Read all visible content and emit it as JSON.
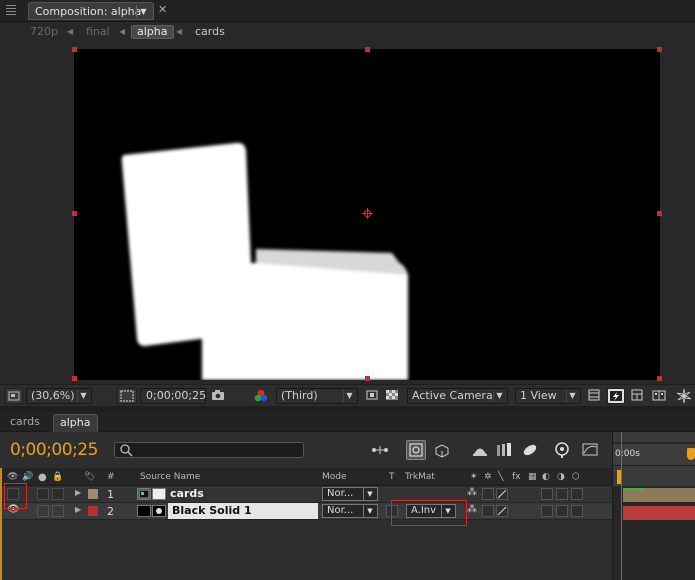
{
  "composition_panel": {
    "tab_title": "Composition: alpha",
    "breadcrumbs": [
      {
        "label": "720p",
        "state": "dim"
      },
      {
        "label": "final",
        "state": "dim"
      },
      {
        "label": "alpha",
        "state": "active"
      },
      {
        "label": "cards",
        "state": "normal"
      }
    ]
  },
  "viewer_footer": {
    "magnification": "(30,6%)",
    "timecode": "0;00;00;25",
    "resolution": "(Third)",
    "camera": "Active Camera",
    "views": "1 View"
  },
  "timeline": {
    "tabs": [
      {
        "label": "cards",
        "active": false
      },
      {
        "label": "alpha",
        "active": true
      }
    ],
    "current_time": "0;00;00;25",
    "columns": {
      "number": "#",
      "source_name": "Source Name",
      "mode": "Mode",
      "t": "T",
      "trkmat": "TrkMat",
      "fx": "fx"
    },
    "layers": [
      {
        "number": "1",
        "name": "cards",
        "mode": "Nor...",
        "trkmat": "",
        "label_color": "#a08a6a"
      },
      {
        "number": "2",
        "name": "Black Solid 1",
        "mode": "Nor...",
        "trkmat": "A.Inv",
        "label_color": "#b33232"
      }
    ],
    "ruler_label": "0:00s"
  },
  "colors": {
    "accent_timecode": "#e6a21a",
    "handle_red": "#c4302b",
    "highlight_red": "#d32a2a"
  }
}
